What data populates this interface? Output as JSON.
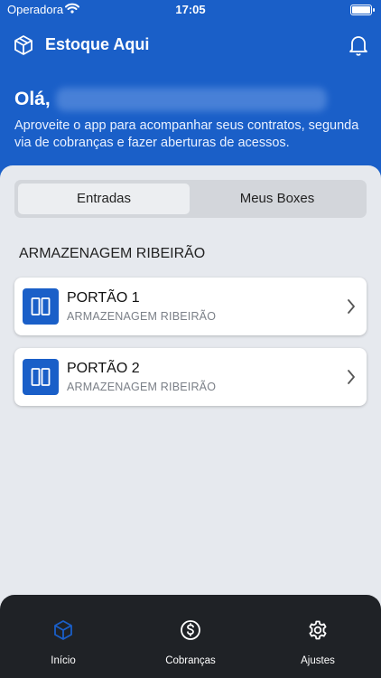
{
  "status_bar": {
    "carrier": "Operadora",
    "time": "17:05"
  },
  "header": {
    "app_title": "Estoque Aqui",
    "greeting": "Olá,",
    "subtitle": "Aproveite o app para acompanhar seus contratos, segunda via de cobranças e fazer aberturas de acessos."
  },
  "tabs": [
    {
      "label": "Entradas",
      "selected": true
    },
    {
      "label": "Meus Boxes",
      "selected": false
    }
  ],
  "section": {
    "title": "ARMAZENAGEM RIBEIRÃO"
  },
  "gates": [
    {
      "title": "PORTÃO 1",
      "subtitle": "ARMAZENAGEM RIBEIRÃO"
    },
    {
      "title": "PORTÃO 2",
      "subtitle": "ARMAZENAGEM RIBEIRÃO"
    }
  ],
  "bottom_nav": [
    {
      "label": "Início",
      "icon": "cube-icon",
      "active": true
    },
    {
      "label": "Cobranças",
      "icon": "dollar-circle-icon",
      "active": false
    },
    {
      "label": "Ajustes",
      "icon": "gear-icon",
      "active": false
    }
  ],
  "colors": {
    "primary": "#1a5fc8",
    "background": "#e6e9ee",
    "nav_bg": "#1f2226",
    "nav_active": "#1a5fc8"
  }
}
